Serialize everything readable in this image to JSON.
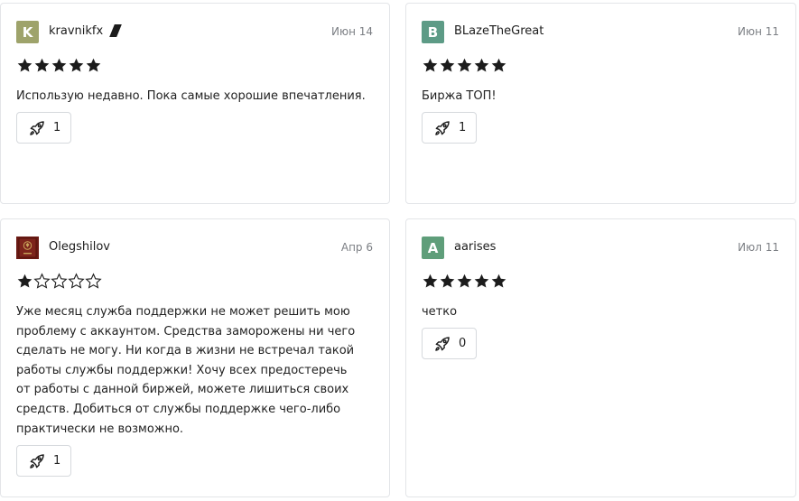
{
  "reviews": [
    {
      "avatar_letter": "K",
      "avatar_color": "#9ea36b",
      "username": "kravnikfx",
      "date": "Июн 14",
      "rating": 5,
      "text": "Использую недавно. Пока самые хорошие впечатления.",
      "likes": "1"
    },
    {
      "avatar_letter": "B",
      "avatar_color": "#5d9b86",
      "username": "BLazeTheGreat",
      "date": "Июн 11",
      "rating": 5,
      "text": "Биржа ТОП!",
      "likes": "1"
    },
    {
      "avatar_letter": "",
      "avatar_color": "#6b1a14",
      "username": "Olegshilov",
      "date": "Апр 6",
      "rating": 1,
      "text": "Уже месяц служба поддержки не может решить мою проблему с аккаунтом. Средства заморожены ни чего сделать не могу. Ни когда в жизни не встречал такой работы службы поддержки! Хочу всех предостеречь от работы с данной биржей, можете лишиться своих средств. Добиться от службы поддержке чего-либо практически не возможно.",
      "likes": "1"
    },
    {
      "avatar_letter": "A",
      "avatar_color": "#5f9e7a",
      "username": "aarises",
      "date": "Июл 11",
      "rating": 5,
      "text": "четко",
      "likes": "0"
    }
  ],
  "icons": {
    "star_filled": "star-filled-icon",
    "star_empty": "star-empty-icon",
    "like": "rocket-icon",
    "badge": "slash-badge-icon",
    "avatar_image": "passport-icon"
  },
  "colors": {
    "star": "#1c1c1c",
    "border": "#e3e5e8",
    "date": "#7c7f84"
  }
}
